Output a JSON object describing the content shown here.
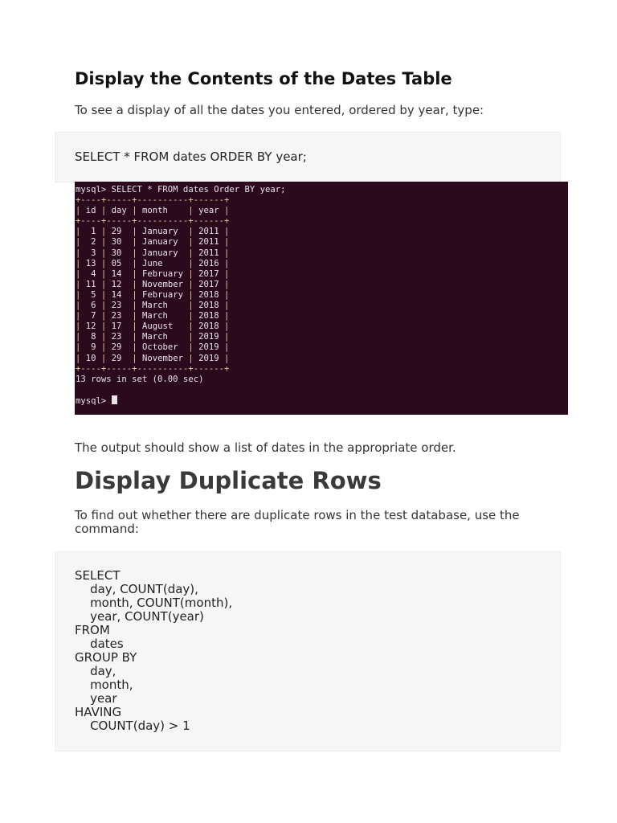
{
  "section1": {
    "heading": "Display the Contents of the Dates Table",
    "intro": "To see a display of all the dates you entered, ordered by year, type:",
    "code": "SELECT * FROM dates ORDER BY year;",
    "terminal": {
      "prompt": "mysql>",
      "command": "SELECT * FROM dates Order BY year;",
      "columns": [
        "id",
        "day",
        "month",
        "year"
      ],
      "rows": [
        [
          "1",
          "29",
          "January",
          "2011"
        ],
        [
          "2",
          "30",
          "January",
          "2011"
        ],
        [
          "3",
          "30",
          "January",
          "2011"
        ],
        [
          "13",
          "05",
          "June",
          "2016"
        ],
        [
          "4",
          "14",
          "February",
          "2017"
        ],
        [
          "11",
          "12",
          "November",
          "2017"
        ],
        [
          "5",
          "14",
          "February",
          "2018"
        ],
        [
          "6",
          "23",
          "March",
          "2018"
        ],
        [
          "7",
          "23",
          "March",
          "2018"
        ],
        [
          "12",
          "17",
          "August",
          "2018"
        ],
        [
          "8",
          "23",
          "March",
          "2019"
        ],
        [
          "9",
          "29",
          "October",
          "2019"
        ],
        [
          "10",
          "29",
          "November",
          "2019"
        ]
      ],
      "summary": "13 rows in set (0.00 sec)"
    },
    "outro": "The output should show a list of dates in the appropriate order."
  },
  "section2": {
    "heading": "Display Duplicate Rows",
    "intro": "To find out whether there are duplicate rows in the test database, use the command:",
    "code": "SELECT\n    day, COUNT(day),\n    month, COUNT(month),\n    year, COUNT(year)\nFROM\n    dates\nGROUP BY\n    day,\n    month,\n    year\nHAVING\n    COUNT(day) > 1"
  }
}
